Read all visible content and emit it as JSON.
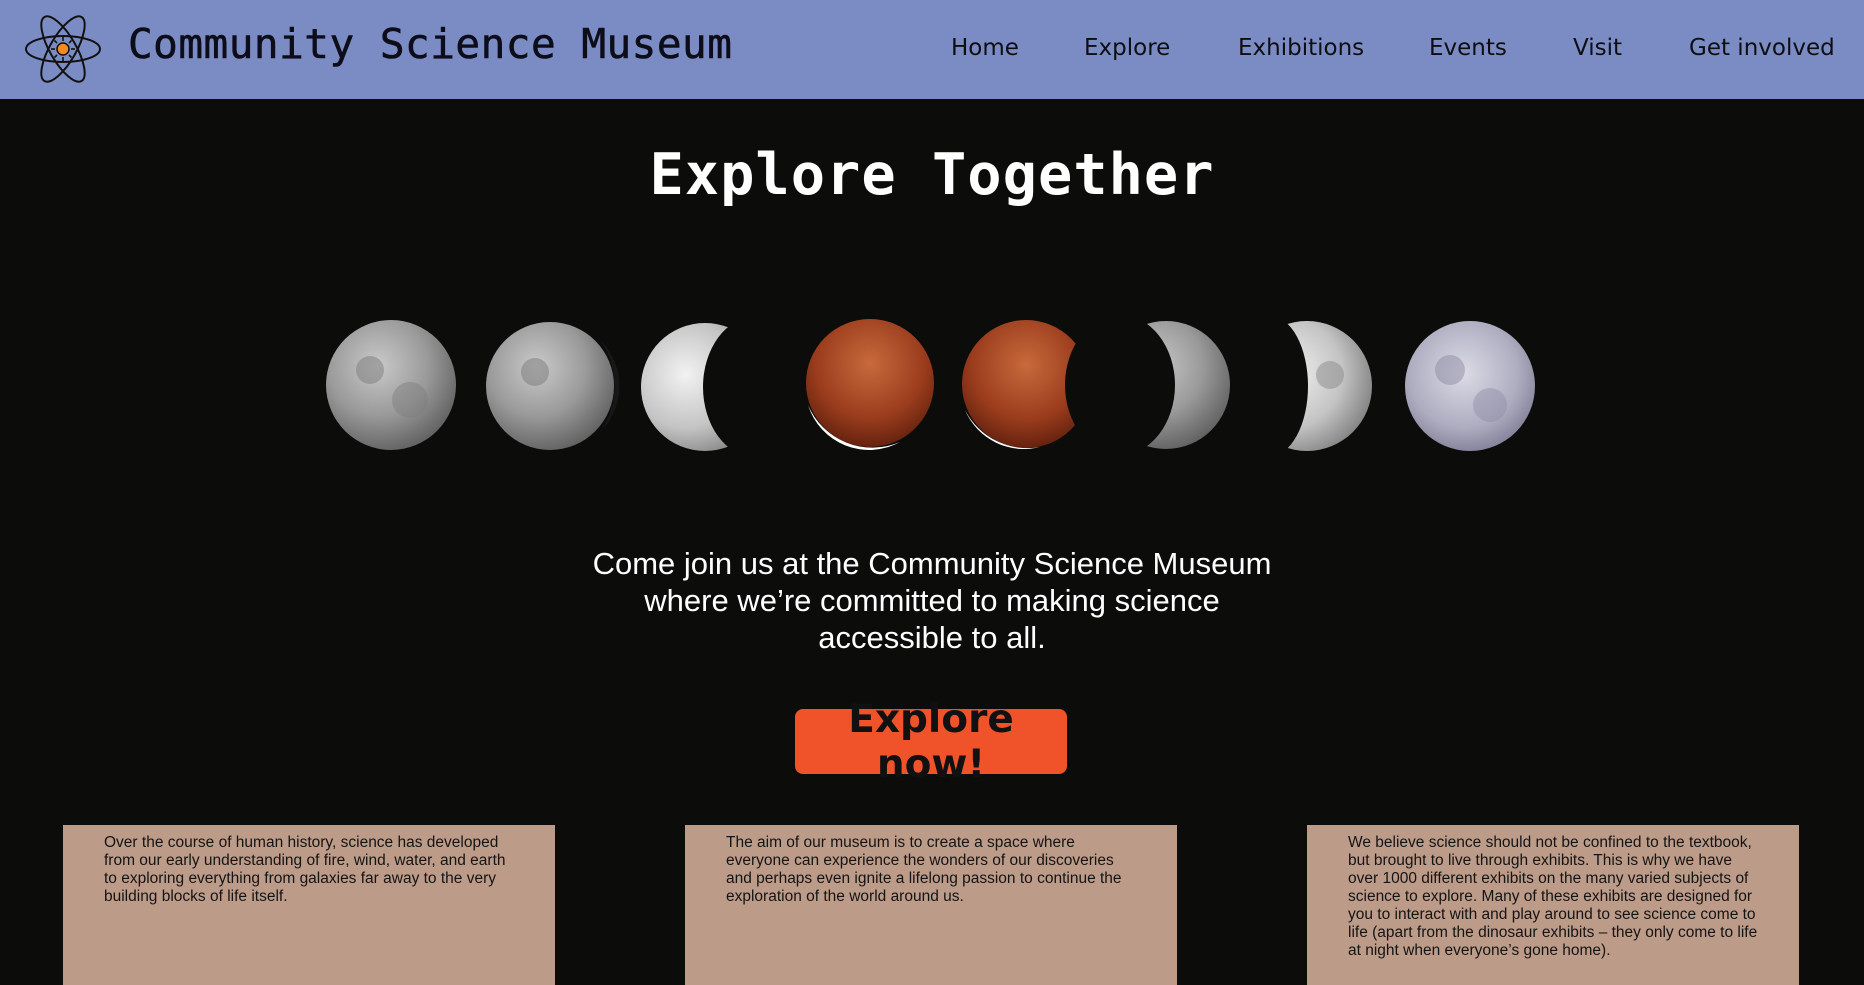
{
  "header": {
    "site_title": "Community Science Museum",
    "nav": [
      "Home",
      "Explore",
      "Exhibitions",
      "Events",
      "Visit",
      "Get involved"
    ]
  },
  "hero": {
    "title": "Explore Together",
    "tagline_lines": [
      "Come join us at the Community Science Museum",
      "where we’re committed to making science",
      "accessible to all."
    ],
    "cta_label": "Explore now!"
  },
  "cards": [
    {
      "text": "Over the course of human history, science has developed from our early understanding of fire, wind, water, and earth to exploring everything from galaxies far away to the very building blocks of life itself."
    },
    {
      "text": "The aim of our museum is to create a space where everyone can experience the wonders of our discoveries and perhaps even ignite a lifelong passion to continue the exploration of the world around us."
    },
    {
      "text": "We believe science should not be confined to the textbook, but brought to live through exhibits. This is why we have over 1000 different exhibits on the many varied subjects of science to explore. Many of these exhibits are designed for you to interact with and play around to see science come to life (apart from the dinosaur exhibits – they only come to life at night when everyone’s gone home)."
    }
  ],
  "colors": {
    "header_bg": "#7b8cc4",
    "page_bg": "#0c0c0b",
    "cta_bg": "#f0522a",
    "card_bg": "#bd9b89"
  },
  "icons": {
    "logo": "atom-icon"
  },
  "image": {
    "subject": "lunar eclipse phases sequence",
    "moon_count": 8
  }
}
